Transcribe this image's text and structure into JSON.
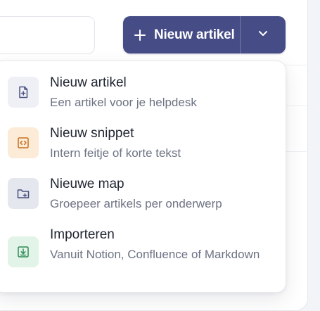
{
  "header": {
    "new_article_button": {
      "label": "Nieuw artikel",
      "icon": "plus-icon",
      "dropdown_icon": "chevron-down-icon"
    }
  },
  "menu": {
    "items": [
      {
        "title": "Nieuw artikel",
        "description": "Een artikel voor je helpdesk",
        "icon": "file-plus-icon",
        "icon_bg": "#eef0f6",
        "icon_color": "#4a517f"
      },
      {
        "title": "Nieuw snippet",
        "description": "Intern feitje of korte tekst",
        "icon": "code-file-icon",
        "icon_bg": "#fcebd7",
        "icon_color": "#c9701e"
      },
      {
        "title": "Nieuwe map",
        "description": "Groepeer artikels per onderwerp",
        "icon": "folder-plus-icon",
        "icon_bg": "#e5e7ef",
        "icon_color": "#4a517f"
      },
      {
        "title": "Importeren",
        "description": "Vanuit Notion, Confluence of Markdown",
        "icon": "download-icon",
        "icon_bg": "#e2f3e8",
        "icon_color": "#2f8a55"
      }
    ]
  },
  "colors": {
    "primary": "#454c86",
    "background": "#f3f4f7"
  }
}
